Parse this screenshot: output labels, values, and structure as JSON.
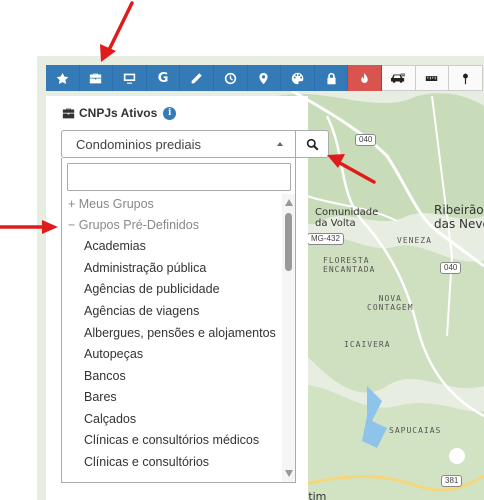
{
  "toolbar": {
    "buttons": [
      {
        "name": "star-icon"
      },
      {
        "name": "briefcase-icon"
      },
      {
        "name": "monitor-icon"
      },
      {
        "name": "google-icon",
        "glyph": "G"
      },
      {
        "name": "pencil-icon"
      },
      {
        "name": "clock-icon"
      },
      {
        "name": "map-pin-icon"
      },
      {
        "name": "palette-icon"
      },
      {
        "name": "lock-icon"
      },
      {
        "name": "fire-icon"
      },
      {
        "name": "car-icon"
      },
      {
        "name": "ruler-icon"
      },
      {
        "name": "pushpin-icon"
      }
    ],
    "colors": {
      "blue": "#337ab7",
      "red": "#d9534f"
    }
  },
  "panel": {
    "title": "CNPJs Ativos",
    "info_icon": "i",
    "select_value": "Condominios prediais",
    "search_value": "",
    "groups": [
      {
        "label": "+ Meus Grupos"
      },
      {
        "label": "− Grupos Pré-Definidos"
      }
    ],
    "items": [
      "Academias",
      "Administração pública",
      "Agências de publicidade",
      "Agências de viagens",
      "Albergues, pensões e alojamentos",
      "Autopeças",
      "Bancos",
      "Bares",
      "Calçados",
      "Clínicas e consultórios médicos",
      "Clínicas e consultórios"
    ]
  },
  "map": {
    "labels": {
      "comunidade": "Comunidade\nda Volta",
      "floresta": "FLORESTA\nENCANTADA",
      "venezа": "VENEZA",
      "nova_contagem": "NOVA\nCONTAGEM",
      "icaivera": "ICAIVERA",
      "sapucaias": "SAPUCAIAS",
      "ribeirao": "Ribeirão\ndas Neves",
      "betim": "Betim"
    },
    "shields": {
      "r040a": "040",
      "r040b": "040",
      "mg432": "MG-432",
      "r381": "381"
    }
  }
}
